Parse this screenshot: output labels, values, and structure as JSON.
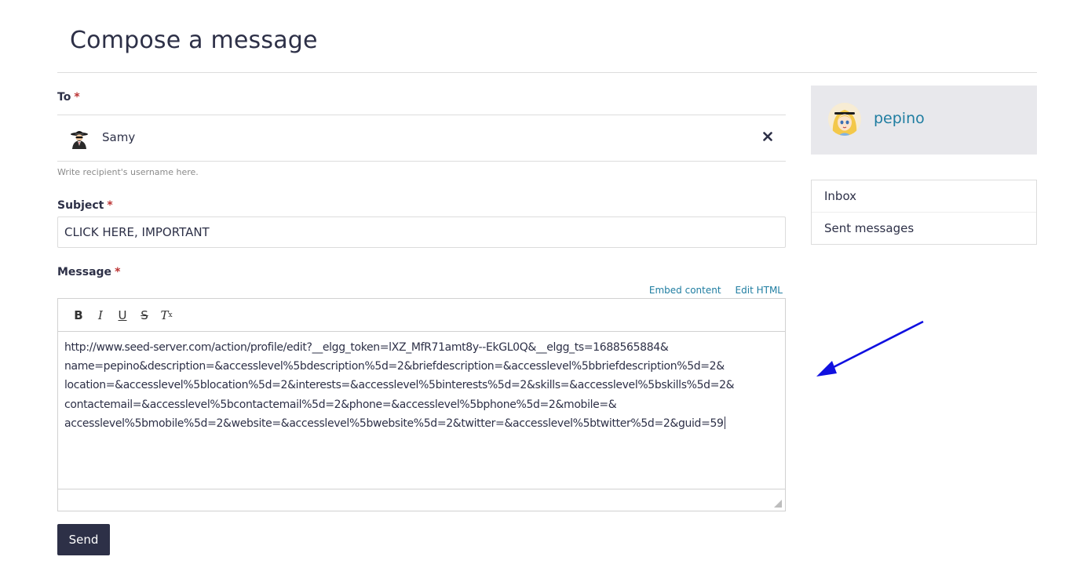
{
  "page": {
    "title": "Compose a message"
  },
  "form": {
    "to_label": "To",
    "required_marker": "*",
    "recipient": {
      "name": "Samy",
      "remove_icon": "close-icon"
    },
    "recipient_help": "Write recipient's username here.",
    "subject_label": "Subject",
    "subject_value": "CLICK HERE, IMPORTANT",
    "message_label": "Message",
    "editor_links": {
      "embed": "Embed content",
      "edit_html": "Edit HTML"
    },
    "toolbar": {
      "bold": "B",
      "italic": "I",
      "underline": "U",
      "strike": "S",
      "clear": "T",
      "clear_sub": "x"
    },
    "message_lines": [
      "http://www.seed-server.com/action/profile/edit?__elgg_token=lXZ_MfR71amt8y--EkGL0Q&__elgg_ts=1688565884&",
      "name=pepino&description=&accesslevel%5bdescription%5d=2&briefdescription=&accesslevel%5bbriefdescription%5d=2&",
      "location=&accesslevel%5blocation%5d=2&interests=&accesslevel%5binterests%5d=2&skills=&accesslevel%5bskills%5d=2&",
      "contactemail=&accesslevel%5bcontactemail%5d=2&phone=&accesslevel%5bphone%5d=2&mobile=&",
      "accesslevel%5bmobile%5d=2&website=&accesslevel%5bwebsite%5d=2&twitter=&accesslevel%5btwitter%5d=2&guid=59"
    ],
    "send_label": "Send"
  },
  "sidebar": {
    "owner_name": "pepino",
    "menu": [
      {
        "label": "Inbox"
      },
      {
        "label": "Sent messages"
      }
    ]
  },
  "colors": {
    "primary": "#2d3047",
    "link": "#1f7da1",
    "required": "#bb3333",
    "annotation_arrow": "#1010e0"
  }
}
